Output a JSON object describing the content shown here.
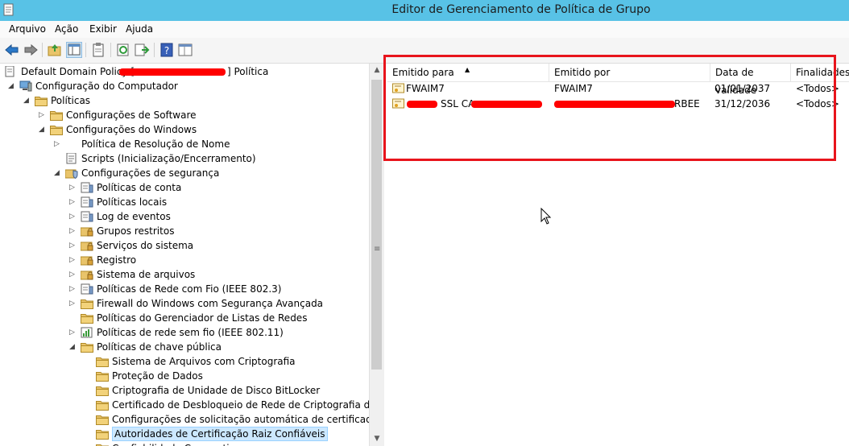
{
  "window": {
    "title": "Editor de Gerenciamento de Política de Grupo"
  },
  "menu": [
    "Arquivo",
    "Ação",
    "Exibir",
    "Ajuda"
  ],
  "tree": {
    "root": {
      "prefix": "Default Domain Policy [",
      "suffix": "] Política"
    },
    "items": [
      {
        "label": "Configuração do Computador",
        "depth": 1,
        "expander": "◢",
        "icon": "computer"
      },
      {
        "label": "Políticas",
        "depth": 2,
        "expander": "◢",
        "icon": "folder"
      },
      {
        "label": "Configurações de Software",
        "depth": 3,
        "expander": "▷",
        "icon": "folder"
      },
      {
        "label": "Configurações do Windows",
        "depth": 3,
        "expander": "◢",
        "icon": "folder"
      },
      {
        "label": "Política de Resolução de Nome",
        "depth": 4,
        "expander": "▷",
        "icon": "none"
      },
      {
        "label": "Scripts (Inicialização/Encerramento)",
        "depth": 4,
        "expander": "",
        "icon": "script"
      },
      {
        "label": "Configurações de segurança",
        "depth": 4,
        "expander": "◢",
        "icon": "shield"
      },
      {
        "label": "Políticas de conta",
        "depth": 5,
        "expander": "▷",
        "icon": "policy"
      },
      {
        "label": "Políticas locais",
        "depth": 5,
        "expander": "▷",
        "icon": "policy"
      },
      {
        "label": "Log de eventos",
        "depth": 5,
        "expander": "▷",
        "icon": "policy"
      },
      {
        "label": "Grupos restritos",
        "depth": 5,
        "expander": "▷",
        "icon": "lockfolder"
      },
      {
        "label": "Serviços do sistema",
        "depth": 5,
        "expander": "▷",
        "icon": "lockfolder"
      },
      {
        "label": "Registro",
        "depth": 5,
        "expander": "▷",
        "icon": "lockfolder"
      },
      {
        "label": "Sistema de arquivos",
        "depth": 5,
        "expander": "▷",
        "icon": "lockfolder"
      },
      {
        "label": "Políticas de Rede com Fio (IEEE 802.3)",
        "depth": 5,
        "expander": "▷",
        "icon": "policy"
      },
      {
        "label": "Firewall do Windows com Segurança Avançada",
        "depth": 5,
        "expander": "▷",
        "icon": "folder"
      },
      {
        "label": "Políticas do Gerenciador de Listas de Redes",
        "depth": 5,
        "expander": "",
        "icon": "folder"
      },
      {
        "label": "Políticas de rede sem fio (IEEE 802.11)",
        "depth": 5,
        "expander": "▷",
        "icon": "chart"
      },
      {
        "label": "Políticas de chave pública",
        "depth": 5,
        "expander": "◢",
        "icon": "folder"
      },
      {
        "label": "Sistema de Arquivos com Criptografia",
        "depth": 6,
        "expander": "",
        "icon": "folder"
      },
      {
        "label": "Proteção de Dados",
        "depth": 6,
        "expander": "",
        "icon": "folder"
      },
      {
        "label": "Criptografia de Unidade de Disco BitLocker",
        "depth": 6,
        "expander": "",
        "icon": "folder"
      },
      {
        "label": "Certificado de Desbloqueio de Rede de Criptografia de Unida",
        "depth": 6,
        "expander": "",
        "icon": "folder"
      },
      {
        "label": "Configurações de solicitação automática de certificado",
        "depth": 6,
        "expander": "",
        "icon": "folder"
      },
      {
        "label": "Autoridades de Certificação Raiz Confiáveis",
        "depth": 6,
        "expander": "",
        "icon": "folder",
        "selected": true
      },
      {
        "label": "Confiabilidade Corporativa",
        "depth": 6,
        "expander": "",
        "icon": "folder"
      }
    ]
  },
  "list": {
    "columns": [
      "Emitido para",
      "Emitido por",
      "Data de validade",
      "Finalidades"
    ],
    "rows": [
      {
        "issued_to": "FWAIM7",
        "issued_by": "FWAIM7",
        "expiry": "01/01/2037",
        "purposes": "<Todos>"
      },
      {
        "issued_to": "SSL CA",
        "issued_by": "RBEE",
        "expiry": "31/12/2036",
        "purposes": "<Todos>"
      }
    ]
  },
  "colors": {
    "titlebar": "#58c2e6",
    "annotation": "#e8141c",
    "redaction": "#ff0000"
  }
}
